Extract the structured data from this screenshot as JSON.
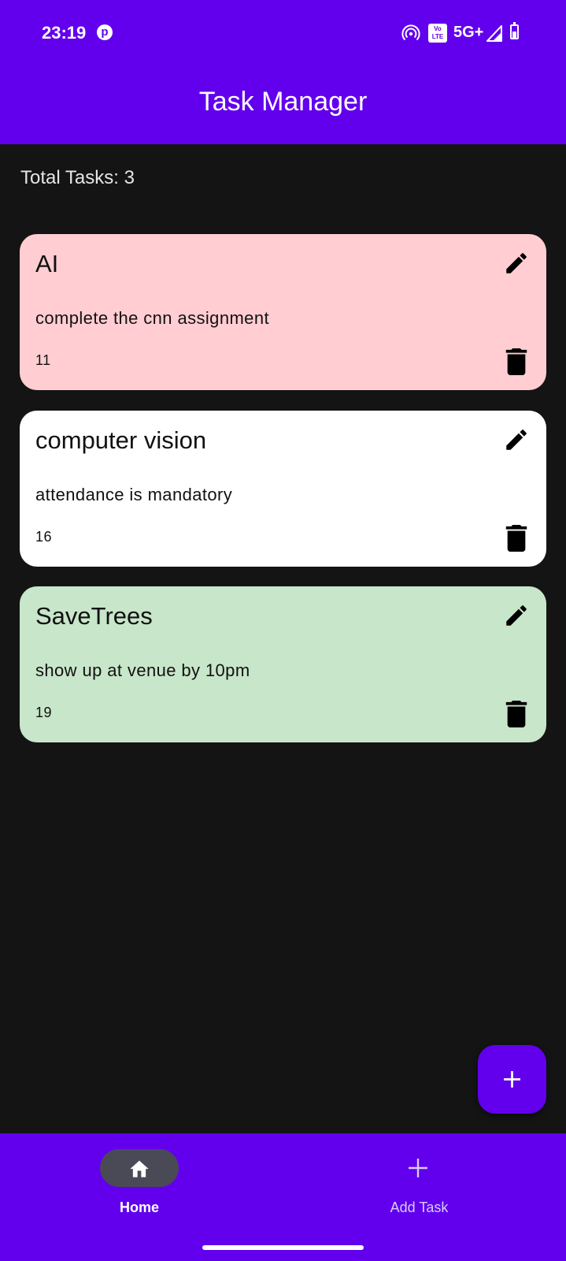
{
  "status_bar": {
    "time": "23:19",
    "network": "5G+",
    "volte_top": "Vo",
    "volte_bottom": "LTE",
    "icons": [
      "pinterest-icon",
      "hotspot-icon",
      "volte-icon",
      "signal-icon",
      "battery-icon"
    ]
  },
  "app_bar": {
    "title": "Task Manager"
  },
  "summary": {
    "total_tasks": "Total Tasks: 3"
  },
  "tasks": [
    {
      "title": "AI",
      "description": "complete the cnn assignment",
      "number": "11",
      "color": "#FFCDD2"
    },
    {
      "title": "computer vision",
      "description": "attendance is mandatory",
      "number": "16",
      "color": "#FFFFFF"
    },
    {
      "title": "SaveTrees",
      "description": "show up at venue by 10pm",
      "number": "19",
      "color": "#C8E6C9"
    }
  ],
  "fab": {
    "icon": "plus-icon"
  },
  "bottom_nav": {
    "items": [
      {
        "label": "Home",
        "icon": "home-icon",
        "selected": true
      },
      {
        "label": "Add Task",
        "icon": "plus-icon",
        "selected": false
      }
    ]
  },
  "colors": {
    "primary": "#6200EE",
    "background": "#141414",
    "nav_indicator": "#4A4A56"
  }
}
